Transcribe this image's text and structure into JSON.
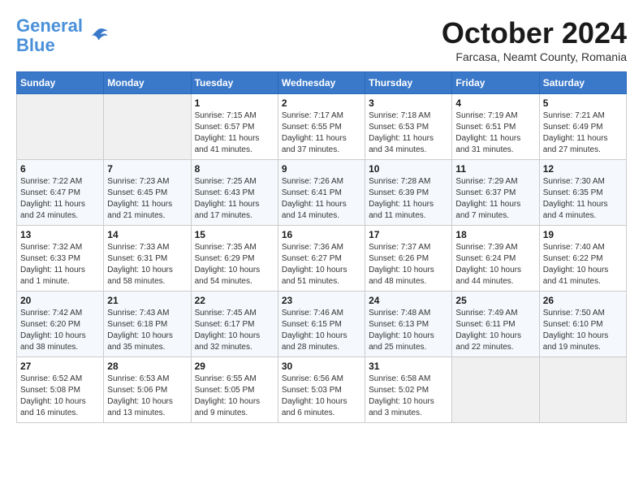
{
  "header": {
    "logo_line1": "General",
    "logo_line2": "Blue",
    "month": "October 2024",
    "subtitle": "Farcasa, Neamt County, Romania"
  },
  "days_of_week": [
    "Sunday",
    "Monday",
    "Tuesday",
    "Wednesday",
    "Thursday",
    "Friday",
    "Saturday"
  ],
  "weeks": [
    [
      {
        "day": "",
        "empty": true
      },
      {
        "day": "",
        "empty": true
      },
      {
        "day": "1",
        "sunrise": "7:15 AM",
        "sunset": "6:57 PM",
        "daylight": "11 hours and 41 minutes."
      },
      {
        "day": "2",
        "sunrise": "7:17 AM",
        "sunset": "6:55 PM",
        "daylight": "11 hours and 37 minutes."
      },
      {
        "day": "3",
        "sunrise": "7:18 AM",
        "sunset": "6:53 PM",
        "daylight": "11 hours and 34 minutes."
      },
      {
        "day": "4",
        "sunrise": "7:19 AM",
        "sunset": "6:51 PM",
        "daylight": "11 hours and 31 minutes."
      },
      {
        "day": "5",
        "sunrise": "7:21 AM",
        "sunset": "6:49 PM",
        "daylight": "11 hours and 27 minutes."
      }
    ],
    [
      {
        "day": "6",
        "sunrise": "7:22 AM",
        "sunset": "6:47 PM",
        "daylight": "11 hours and 24 minutes."
      },
      {
        "day": "7",
        "sunrise": "7:23 AM",
        "sunset": "6:45 PM",
        "daylight": "11 hours and 21 minutes."
      },
      {
        "day": "8",
        "sunrise": "7:25 AM",
        "sunset": "6:43 PM",
        "daylight": "11 hours and 17 minutes."
      },
      {
        "day": "9",
        "sunrise": "7:26 AM",
        "sunset": "6:41 PM",
        "daylight": "11 hours and 14 minutes."
      },
      {
        "day": "10",
        "sunrise": "7:28 AM",
        "sunset": "6:39 PM",
        "daylight": "11 hours and 11 minutes."
      },
      {
        "day": "11",
        "sunrise": "7:29 AM",
        "sunset": "6:37 PM",
        "daylight": "11 hours and 7 minutes."
      },
      {
        "day": "12",
        "sunrise": "7:30 AM",
        "sunset": "6:35 PM",
        "daylight": "11 hours and 4 minutes."
      }
    ],
    [
      {
        "day": "13",
        "sunrise": "7:32 AM",
        "sunset": "6:33 PM",
        "daylight": "11 hours and 1 minute."
      },
      {
        "day": "14",
        "sunrise": "7:33 AM",
        "sunset": "6:31 PM",
        "daylight": "10 hours and 58 minutes."
      },
      {
        "day": "15",
        "sunrise": "7:35 AM",
        "sunset": "6:29 PM",
        "daylight": "10 hours and 54 minutes."
      },
      {
        "day": "16",
        "sunrise": "7:36 AM",
        "sunset": "6:27 PM",
        "daylight": "10 hours and 51 minutes."
      },
      {
        "day": "17",
        "sunrise": "7:37 AM",
        "sunset": "6:26 PM",
        "daylight": "10 hours and 48 minutes."
      },
      {
        "day": "18",
        "sunrise": "7:39 AM",
        "sunset": "6:24 PM",
        "daylight": "10 hours and 44 minutes."
      },
      {
        "day": "19",
        "sunrise": "7:40 AM",
        "sunset": "6:22 PM",
        "daylight": "10 hours and 41 minutes."
      }
    ],
    [
      {
        "day": "20",
        "sunrise": "7:42 AM",
        "sunset": "6:20 PM",
        "daylight": "10 hours and 38 minutes."
      },
      {
        "day": "21",
        "sunrise": "7:43 AM",
        "sunset": "6:18 PM",
        "daylight": "10 hours and 35 minutes."
      },
      {
        "day": "22",
        "sunrise": "7:45 AM",
        "sunset": "6:17 PM",
        "daylight": "10 hours and 32 minutes."
      },
      {
        "day": "23",
        "sunrise": "7:46 AM",
        "sunset": "6:15 PM",
        "daylight": "10 hours and 28 minutes."
      },
      {
        "day": "24",
        "sunrise": "7:48 AM",
        "sunset": "6:13 PM",
        "daylight": "10 hours and 25 minutes."
      },
      {
        "day": "25",
        "sunrise": "7:49 AM",
        "sunset": "6:11 PM",
        "daylight": "10 hours and 22 minutes."
      },
      {
        "day": "26",
        "sunrise": "7:50 AM",
        "sunset": "6:10 PM",
        "daylight": "10 hours and 19 minutes."
      }
    ],
    [
      {
        "day": "27",
        "sunrise": "6:52 AM",
        "sunset": "5:08 PM",
        "daylight": "10 hours and 16 minutes."
      },
      {
        "day": "28",
        "sunrise": "6:53 AM",
        "sunset": "5:06 PM",
        "daylight": "10 hours and 13 minutes."
      },
      {
        "day": "29",
        "sunrise": "6:55 AM",
        "sunset": "5:05 PM",
        "daylight": "10 hours and 9 minutes."
      },
      {
        "day": "30",
        "sunrise": "6:56 AM",
        "sunset": "5:03 PM",
        "daylight": "10 hours and 6 minutes."
      },
      {
        "day": "31",
        "sunrise": "6:58 AM",
        "sunset": "5:02 PM",
        "daylight": "10 hours and 3 minutes."
      },
      {
        "day": "",
        "empty": true
      },
      {
        "day": "",
        "empty": true
      }
    ]
  ]
}
